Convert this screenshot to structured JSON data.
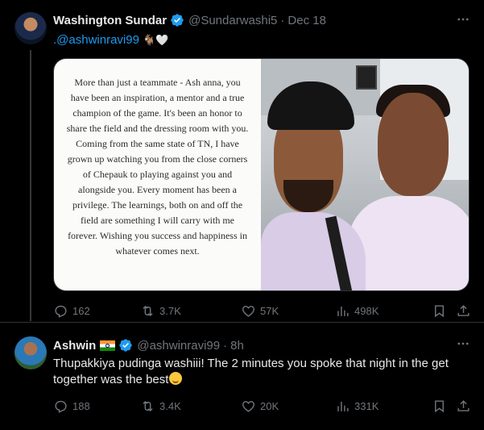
{
  "tweets": [
    {
      "author_name": "Washington Sundar",
      "handle": "@Sundarwashi5",
      "separator": "·",
      "time": "Dec 18",
      "text_mention": ".@ashwinravi99",
      "text_emojis": "🐐🤍",
      "image_note": "More than just a teammate - Ash anna, you have been an inspiration, a mentor and a true champion of the game. It's been an honor to share the field and the dressing room with you. Coming from the same state of TN, I have grown up watching you from the close corners of Chepauk to playing against you and alongside you. Every moment has been a privilege. The learnings, both on and off the field are something I will carry with me forever. Wishing you success and happiness in whatever comes next.",
      "replies": "162",
      "reposts": "3.7K",
      "likes": "57K",
      "views": "498K"
    },
    {
      "author_name": "Ashwin",
      "handle": "@ashwinravi99",
      "separator": "·",
      "time": "8h",
      "text": "Thupakkiya pudinga washiii! The 2 minutes you spoke that night in the get together was the best",
      "replies": "188",
      "reposts": "3.4K",
      "likes": "20K",
      "views": "331K"
    }
  ],
  "icons": {
    "verified": "verified-badge-icon",
    "more": "more-icon",
    "reply": "reply-icon",
    "repost": "repost-icon",
    "like": "heart-icon",
    "views": "views-chart-icon",
    "bookmark": "bookmark-icon",
    "share": "share-icon"
  },
  "colors": {
    "background": "#000000",
    "text": "#e7e9ea",
    "muted": "#71767b",
    "accent": "#1d9bf0"
  }
}
